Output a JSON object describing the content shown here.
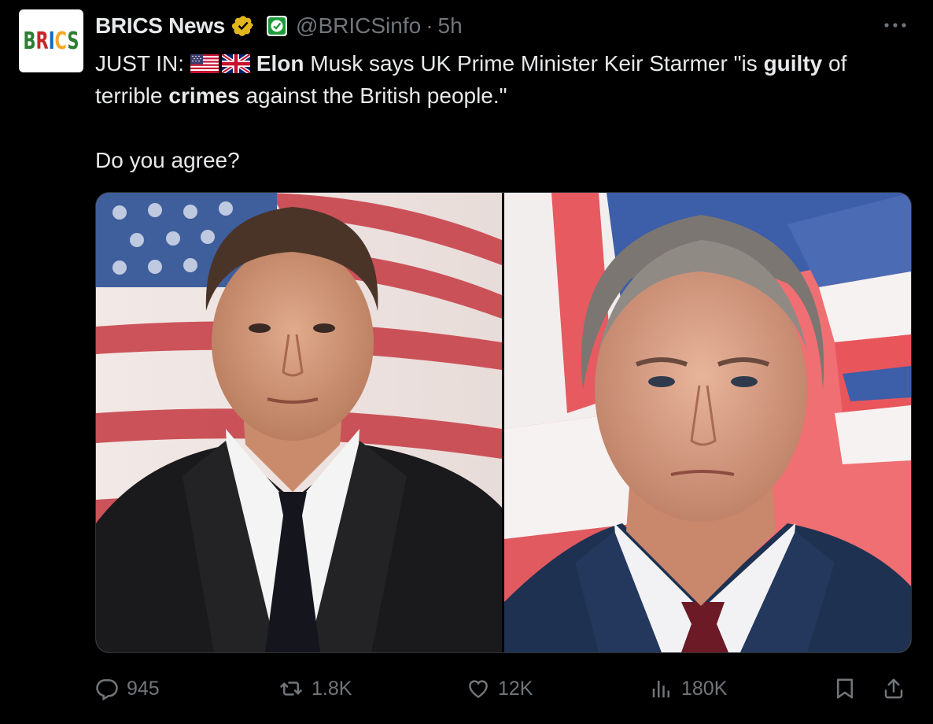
{
  "account": {
    "avatar_text": [
      "B",
      "R",
      "I",
      "C",
      "S"
    ],
    "display_name": "BRICS News",
    "handle": "@BRICSinfo",
    "separator": "·",
    "timestamp": "5h"
  },
  "tweet": {
    "prefix": "JUST IN:",
    "flag_icons": [
      "us-flag-icon",
      "uk-flag-icon"
    ],
    "bold_1": "Elon",
    "text_1": " Musk says UK Prime Minister Keir Starmer \"is ",
    "bold_2": "guilty",
    "text_2": " of terrible ",
    "bold_3": "crimes",
    "text_3": " against the British people.\"",
    "paragraph_2": "Do you agree?"
  },
  "media": {
    "left_image": "photo-elon-musk-us-flag",
    "right_image": "photo-keir-starmer-uk-flag"
  },
  "actions": {
    "replies": "945",
    "reposts": "1.8K",
    "likes": "12K",
    "views": "180K"
  },
  "colors": {
    "background": "#000000",
    "text": "#e7e9ea",
    "secondary": "#71767b",
    "verified": "#e2b719",
    "border": "#2f3336"
  }
}
